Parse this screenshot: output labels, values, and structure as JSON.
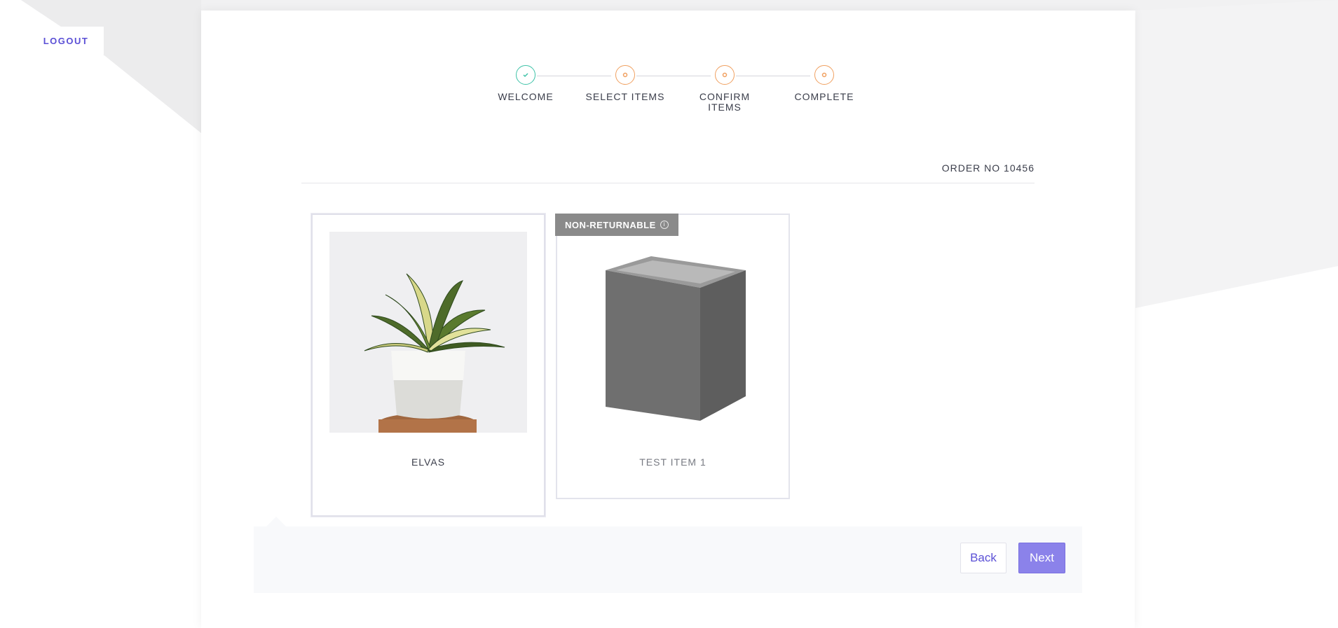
{
  "header": {
    "logout_label": "LOGOUT"
  },
  "stepper": {
    "steps": [
      {
        "label": "WELCOME",
        "status": "complete",
        "icon": "check-icon"
      },
      {
        "label": "SELECT ITEMS",
        "status": "pending",
        "icon": "dot-icon"
      },
      {
        "label": "CONFIRM ITEMS",
        "status": "pending",
        "icon": "dot-icon"
      },
      {
        "label": "COMPLETE",
        "status": "pending",
        "icon": "dot-icon"
      }
    ]
  },
  "order": {
    "label": "ORDER NO 10456"
  },
  "items": [
    {
      "name": "ELVAS",
      "image": "potted-plant-image",
      "selected": true
    },
    {
      "name": "TEST ITEM 1",
      "image": "gray-box-image",
      "badge": "NON-RETURNABLE",
      "returnable": false
    }
  ],
  "footer": {
    "back_label": "Back",
    "next_label": "Next"
  },
  "colors": {
    "accent": "#5b50d6",
    "next_button": "#8b82ea",
    "complete_step": "#3fc3a8",
    "pending_step": "#f0a060",
    "badge": "#8a8a8a"
  }
}
